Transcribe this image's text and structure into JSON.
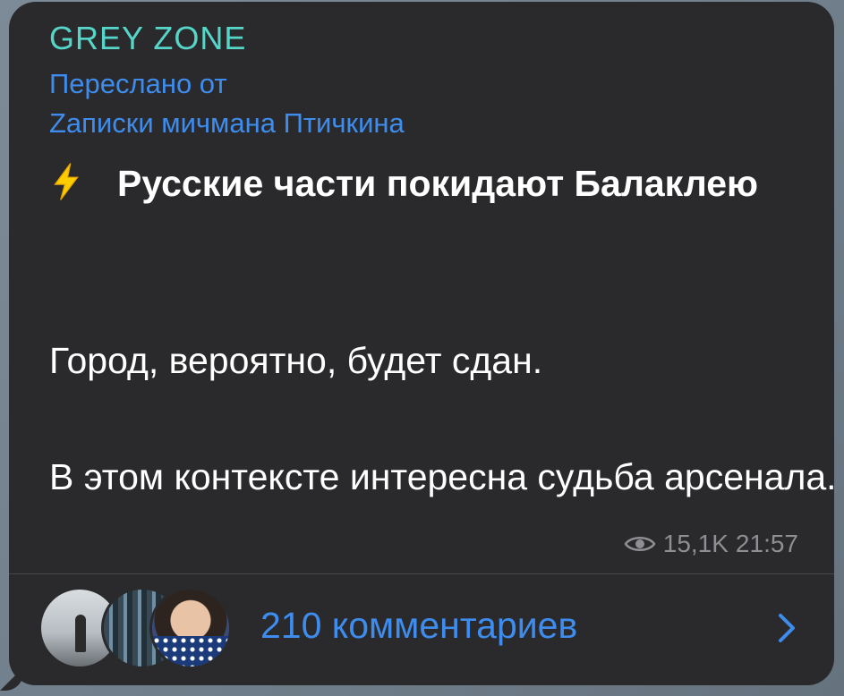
{
  "message": {
    "channel_name": "GREY ZONE",
    "forwarded_label": "Переслано от",
    "forwarded_source": "Zаписки мичмана Птичкина",
    "headline_emoji": "lightning-bolt-icon",
    "headline": "Русские части покидают Балаклею",
    "paragraph1": "Город, вероятно, будет сдан.",
    "paragraph2": "В этом контексте интересна судьба арсенала.",
    "views": "15,1K",
    "time": "21:57"
  },
  "comments": {
    "label": "210 комментариев",
    "avatars": [
      "avatar-1",
      "avatar-2",
      "avatar-3"
    ]
  },
  "colors": {
    "bubble": "#2a2a2c",
    "channel": "#56d6c8",
    "link": "#3e8dee",
    "text": "#ffffff",
    "meta": "#8e8e93"
  }
}
